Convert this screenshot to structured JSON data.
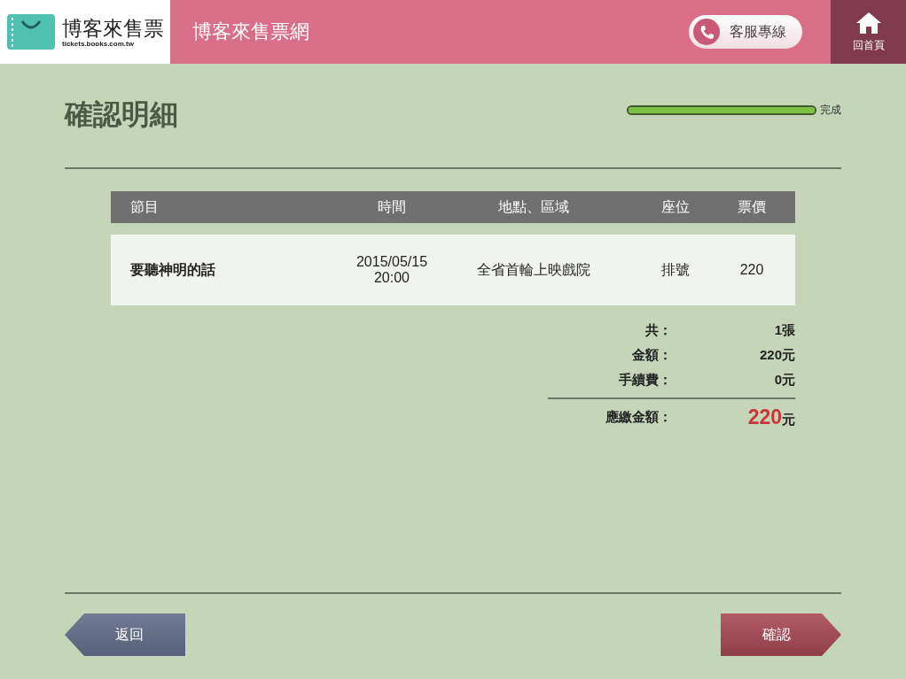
{
  "header": {
    "logo_name": "博客來售票",
    "logo_url": "tickets.books.com.tw",
    "site_title": "博客來售票網",
    "service_button": "客服專線",
    "home_button": "回首頁"
  },
  "page_title": "確認明細",
  "progress": {
    "level": 1,
    "label": "完成"
  },
  "table": {
    "columns": [
      "節目",
      "時間",
      "地點、區域",
      "座位",
      "票價"
    ],
    "rows": [
      {
        "program": "要聽神明的話",
        "date": "2015/05/15",
        "time": "20:00",
        "venue": "全省首輪上映戲院",
        "seat": "排號",
        "price": "220"
      }
    ]
  },
  "totals": [
    {
      "label": "共：",
      "value": "1張"
    },
    {
      "label": "金額：",
      "value": "220元"
    },
    {
      "label": "手續費：",
      "value": "0元"
    }
  ],
  "grand_total": {
    "label": "應繳金額：",
    "amount": "220",
    "unit": "元"
  },
  "buttons": [
    {
      "label": "返回",
      "kind": "back"
    },
    {
      "label": "確認",
      "kind": "next"
    }
  ]
}
